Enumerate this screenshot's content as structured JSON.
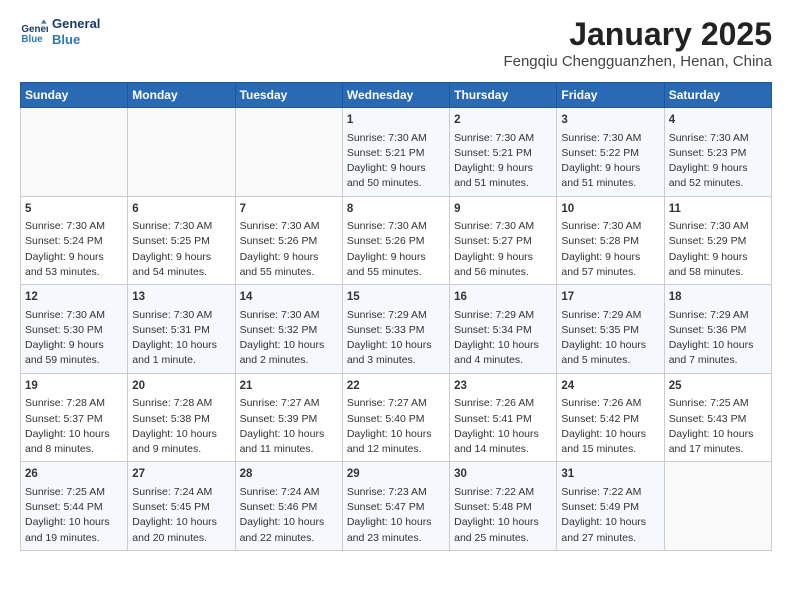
{
  "logo": {
    "line1": "General",
    "line2": "Blue"
  },
  "title": "January 2025",
  "subtitle": "Fengqiu Chengguanzhen, Henan, China",
  "days_of_week": [
    "Sunday",
    "Monday",
    "Tuesday",
    "Wednesday",
    "Thursday",
    "Friday",
    "Saturday"
  ],
  "weeks": [
    [
      {
        "day": "",
        "content": ""
      },
      {
        "day": "",
        "content": ""
      },
      {
        "day": "",
        "content": ""
      },
      {
        "day": "1",
        "content": "Sunrise: 7:30 AM\nSunset: 5:21 PM\nDaylight: 9 hours\nand 50 minutes."
      },
      {
        "day": "2",
        "content": "Sunrise: 7:30 AM\nSunset: 5:21 PM\nDaylight: 9 hours\nand 51 minutes."
      },
      {
        "day": "3",
        "content": "Sunrise: 7:30 AM\nSunset: 5:22 PM\nDaylight: 9 hours\nand 51 minutes."
      },
      {
        "day": "4",
        "content": "Sunrise: 7:30 AM\nSunset: 5:23 PM\nDaylight: 9 hours\nand 52 minutes."
      }
    ],
    [
      {
        "day": "5",
        "content": "Sunrise: 7:30 AM\nSunset: 5:24 PM\nDaylight: 9 hours\nand 53 minutes."
      },
      {
        "day": "6",
        "content": "Sunrise: 7:30 AM\nSunset: 5:25 PM\nDaylight: 9 hours\nand 54 minutes."
      },
      {
        "day": "7",
        "content": "Sunrise: 7:30 AM\nSunset: 5:26 PM\nDaylight: 9 hours\nand 55 minutes."
      },
      {
        "day": "8",
        "content": "Sunrise: 7:30 AM\nSunset: 5:26 PM\nDaylight: 9 hours\nand 55 minutes."
      },
      {
        "day": "9",
        "content": "Sunrise: 7:30 AM\nSunset: 5:27 PM\nDaylight: 9 hours\nand 56 minutes."
      },
      {
        "day": "10",
        "content": "Sunrise: 7:30 AM\nSunset: 5:28 PM\nDaylight: 9 hours\nand 57 minutes."
      },
      {
        "day": "11",
        "content": "Sunrise: 7:30 AM\nSunset: 5:29 PM\nDaylight: 9 hours\nand 58 minutes."
      }
    ],
    [
      {
        "day": "12",
        "content": "Sunrise: 7:30 AM\nSunset: 5:30 PM\nDaylight: 9 hours\nand 59 minutes."
      },
      {
        "day": "13",
        "content": "Sunrise: 7:30 AM\nSunset: 5:31 PM\nDaylight: 10 hours\nand 1 minute."
      },
      {
        "day": "14",
        "content": "Sunrise: 7:30 AM\nSunset: 5:32 PM\nDaylight: 10 hours\nand 2 minutes."
      },
      {
        "day": "15",
        "content": "Sunrise: 7:29 AM\nSunset: 5:33 PM\nDaylight: 10 hours\nand 3 minutes."
      },
      {
        "day": "16",
        "content": "Sunrise: 7:29 AM\nSunset: 5:34 PM\nDaylight: 10 hours\nand 4 minutes."
      },
      {
        "day": "17",
        "content": "Sunrise: 7:29 AM\nSunset: 5:35 PM\nDaylight: 10 hours\nand 5 minutes."
      },
      {
        "day": "18",
        "content": "Sunrise: 7:29 AM\nSunset: 5:36 PM\nDaylight: 10 hours\nand 7 minutes."
      }
    ],
    [
      {
        "day": "19",
        "content": "Sunrise: 7:28 AM\nSunset: 5:37 PM\nDaylight: 10 hours\nand 8 minutes."
      },
      {
        "day": "20",
        "content": "Sunrise: 7:28 AM\nSunset: 5:38 PM\nDaylight: 10 hours\nand 9 minutes."
      },
      {
        "day": "21",
        "content": "Sunrise: 7:27 AM\nSunset: 5:39 PM\nDaylight: 10 hours\nand 11 minutes."
      },
      {
        "day": "22",
        "content": "Sunrise: 7:27 AM\nSunset: 5:40 PM\nDaylight: 10 hours\nand 12 minutes."
      },
      {
        "day": "23",
        "content": "Sunrise: 7:26 AM\nSunset: 5:41 PM\nDaylight: 10 hours\nand 14 minutes."
      },
      {
        "day": "24",
        "content": "Sunrise: 7:26 AM\nSunset: 5:42 PM\nDaylight: 10 hours\nand 15 minutes."
      },
      {
        "day": "25",
        "content": "Sunrise: 7:25 AM\nSunset: 5:43 PM\nDaylight: 10 hours\nand 17 minutes."
      }
    ],
    [
      {
        "day": "26",
        "content": "Sunrise: 7:25 AM\nSunset: 5:44 PM\nDaylight: 10 hours\nand 19 minutes."
      },
      {
        "day": "27",
        "content": "Sunrise: 7:24 AM\nSunset: 5:45 PM\nDaylight: 10 hours\nand 20 minutes."
      },
      {
        "day": "28",
        "content": "Sunrise: 7:24 AM\nSunset: 5:46 PM\nDaylight: 10 hours\nand 22 minutes."
      },
      {
        "day": "29",
        "content": "Sunrise: 7:23 AM\nSunset: 5:47 PM\nDaylight: 10 hours\nand 23 minutes."
      },
      {
        "day": "30",
        "content": "Sunrise: 7:22 AM\nSunset: 5:48 PM\nDaylight: 10 hours\nand 25 minutes."
      },
      {
        "day": "31",
        "content": "Sunrise: 7:22 AM\nSunset: 5:49 PM\nDaylight: 10 hours\nand 27 minutes."
      },
      {
        "day": "",
        "content": ""
      }
    ]
  ]
}
